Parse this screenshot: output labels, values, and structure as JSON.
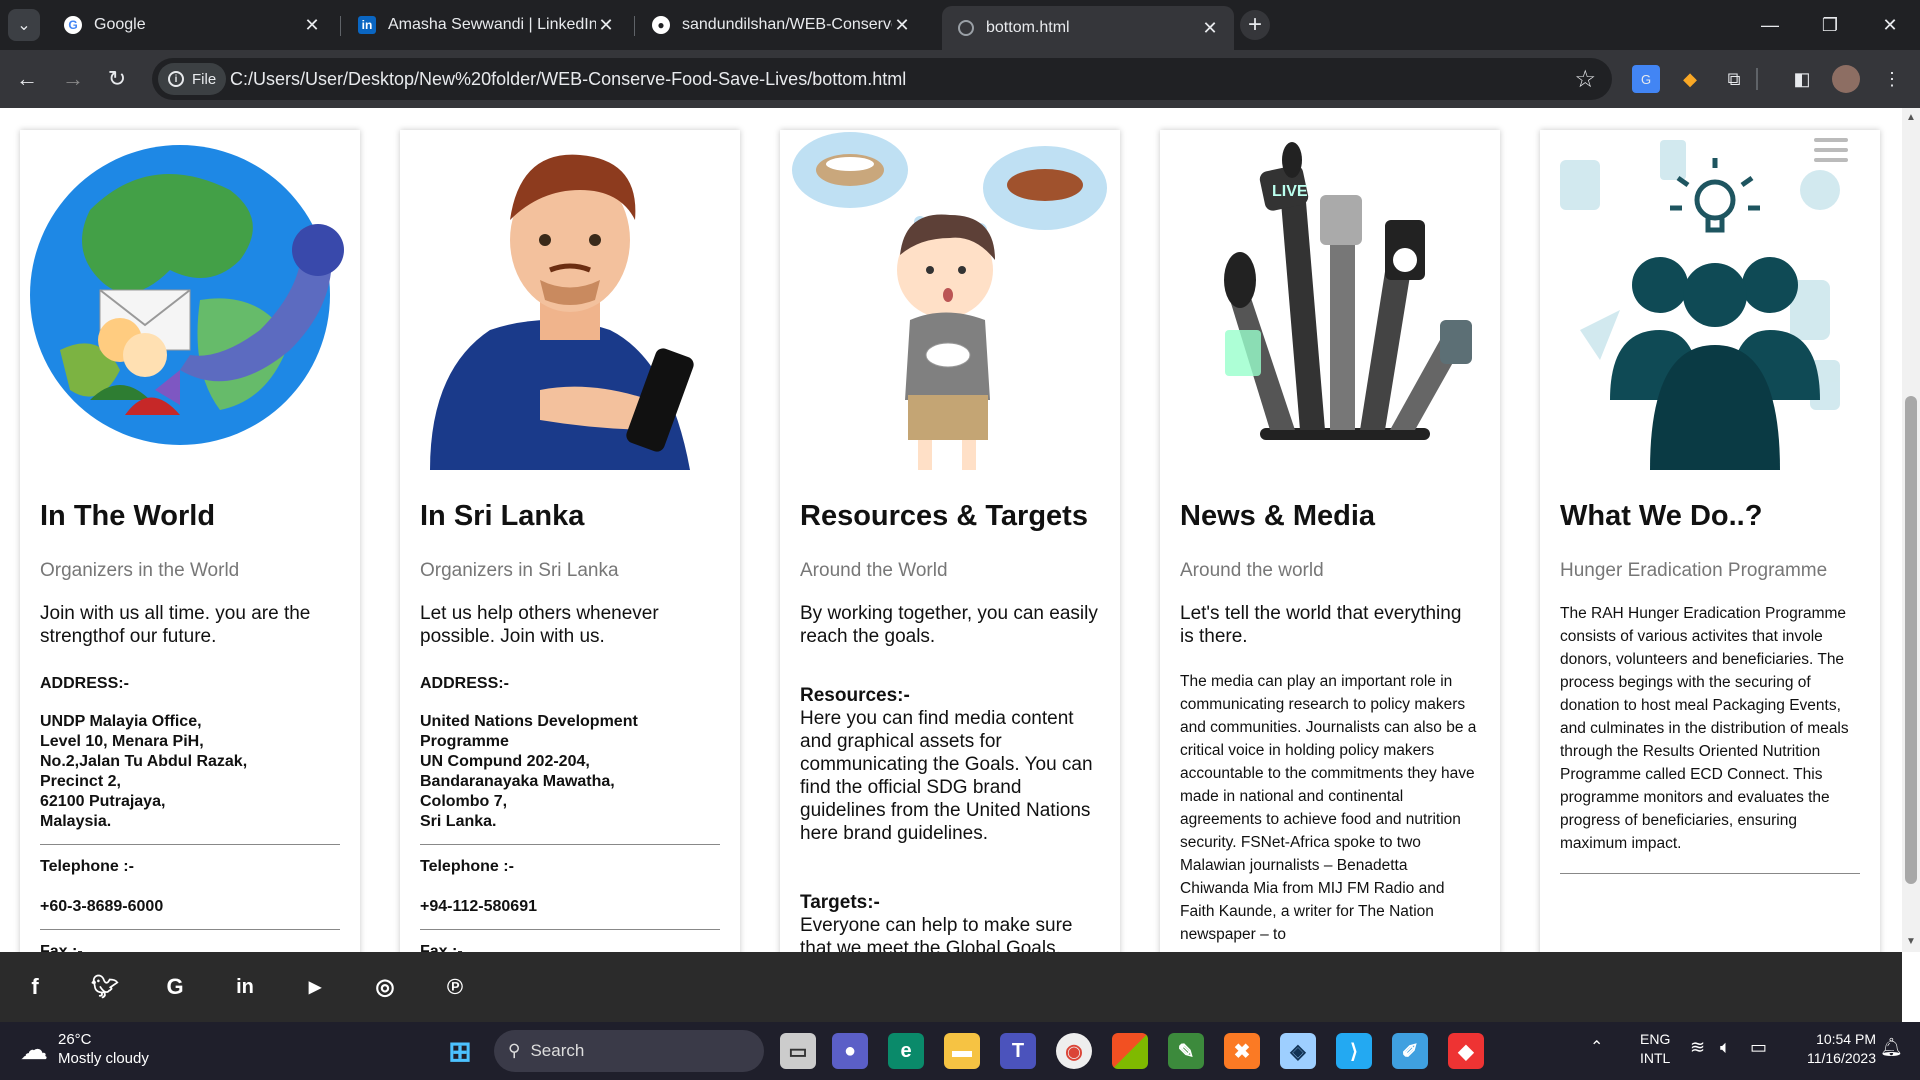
{
  "browser": {
    "tabs": [
      {
        "title": "Google",
        "icon": "google-icon"
      },
      {
        "title": "Amasha Sewwandi | LinkedIn",
        "icon": "linkedin-icon"
      },
      {
        "title": "sandundilshan/WEB-Conserve",
        "icon": "github-icon"
      },
      {
        "title": "bottom.html",
        "icon": "globe-icon"
      }
    ],
    "chip_label": "File",
    "url": "C:/Users/User/Desktop/New%20folder/WEB-Conserve-Food-Save-Lives/bottom.html"
  },
  "cards": [
    {
      "title": "In The World",
      "subtitle": "Organizers in the World",
      "lead": "Join with us all time. you are the strengthof our future.",
      "address_label": "ADDRESS:-",
      "address": [
        "UNDP Malayia Office,",
        "Level 10, Menara PiH,",
        "No.2,Jalan Tu Abdul Razak,",
        "Precinct 2,",
        "62100 Putrajaya,",
        "Malaysia."
      ],
      "tel_label": "Telephone :-",
      "tel": "+60-3-8689-6000",
      "fax_label": "Fax :-"
    },
    {
      "title": "In Sri Lanka",
      "subtitle": "Organizers in Sri Lanka",
      "lead": "Let us help others whenever possible. Join with us.",
      "address_label": "ADDRESS:-",
      "address": [
        "United Nations Development Programme",
        "UN Compund 202-204,",
        "Bandaranayaka Mawatha,",
        "Colombo 7,",
        "Sri Lanka."
      ],
      "tel_label": "Telephone :-",
      "tel": "+94-112-580691",
      "fax_label": "Fax :-"
    },
    {
      "title": "Resources & Targets",
      "subtitle": "Around the World",
      "lead": "By working together, you can easily reach the goals.",
      "resources_label": "Resources:-",
      "resources": "Here you can find media content and graphical assets for communicating the Goals. You can find the official SDG brand guidelines from the United Nations here brand guidelines.",
      "targets_label": "Targets:-",
      "targets": "Everyone can help to make sure that we meet the Global Goals."
    },
    {
      "title": "News & Media",
      "subtitle": "Around the world",
      "lead": "Let's tell the world that everything is there.",
      "text": "The media can play an important role in communicating research to policy makers and communities. Journalists can also be a critical voice in holding policy makers accountable to the commitments they have made in national and continental agreements to achieve food and nutrition security. FSNet-Africa spoke to two Malawian journalists – Benadetta Chiwanda Mia from MIJ FM Radio and Faith Kaunde, a writer for The Nation newspaper – to"
    },
    {
      "title": "What We Do..?",
      "subtitle": "Hunger Eradication Programme",
      "text": "The RAH Hunger Eradication Programme consists of various activites that invole donors, volunteers and beneficiaries. The process begings with the securing of donation to host meal Packaging Events, and culminates in the distribution of meals through the Results Oriented Nutrition Programme called ECD Connect. This programme monitors and evaluates the progress of beneficiaries, ensuring maximum impact."
    }
  ],
  "footer_social": [
    "facebook-icon",
    "twitter-icon",
    "google-icon",
    "linkedin-icon",
    "youtube-icon",
    "instagram-icon",
    "pinterest-icon"
  ],
  "taskbar": {
    "temp": "26°C",
    "weather": "Mostly cloudy",
    "search_placeholder": "Search",
    "lang1": "ENG",
    "lang2": "INTL",
    "time": "10:54 PM",
    "date": "11/16/2023"
  }
}
